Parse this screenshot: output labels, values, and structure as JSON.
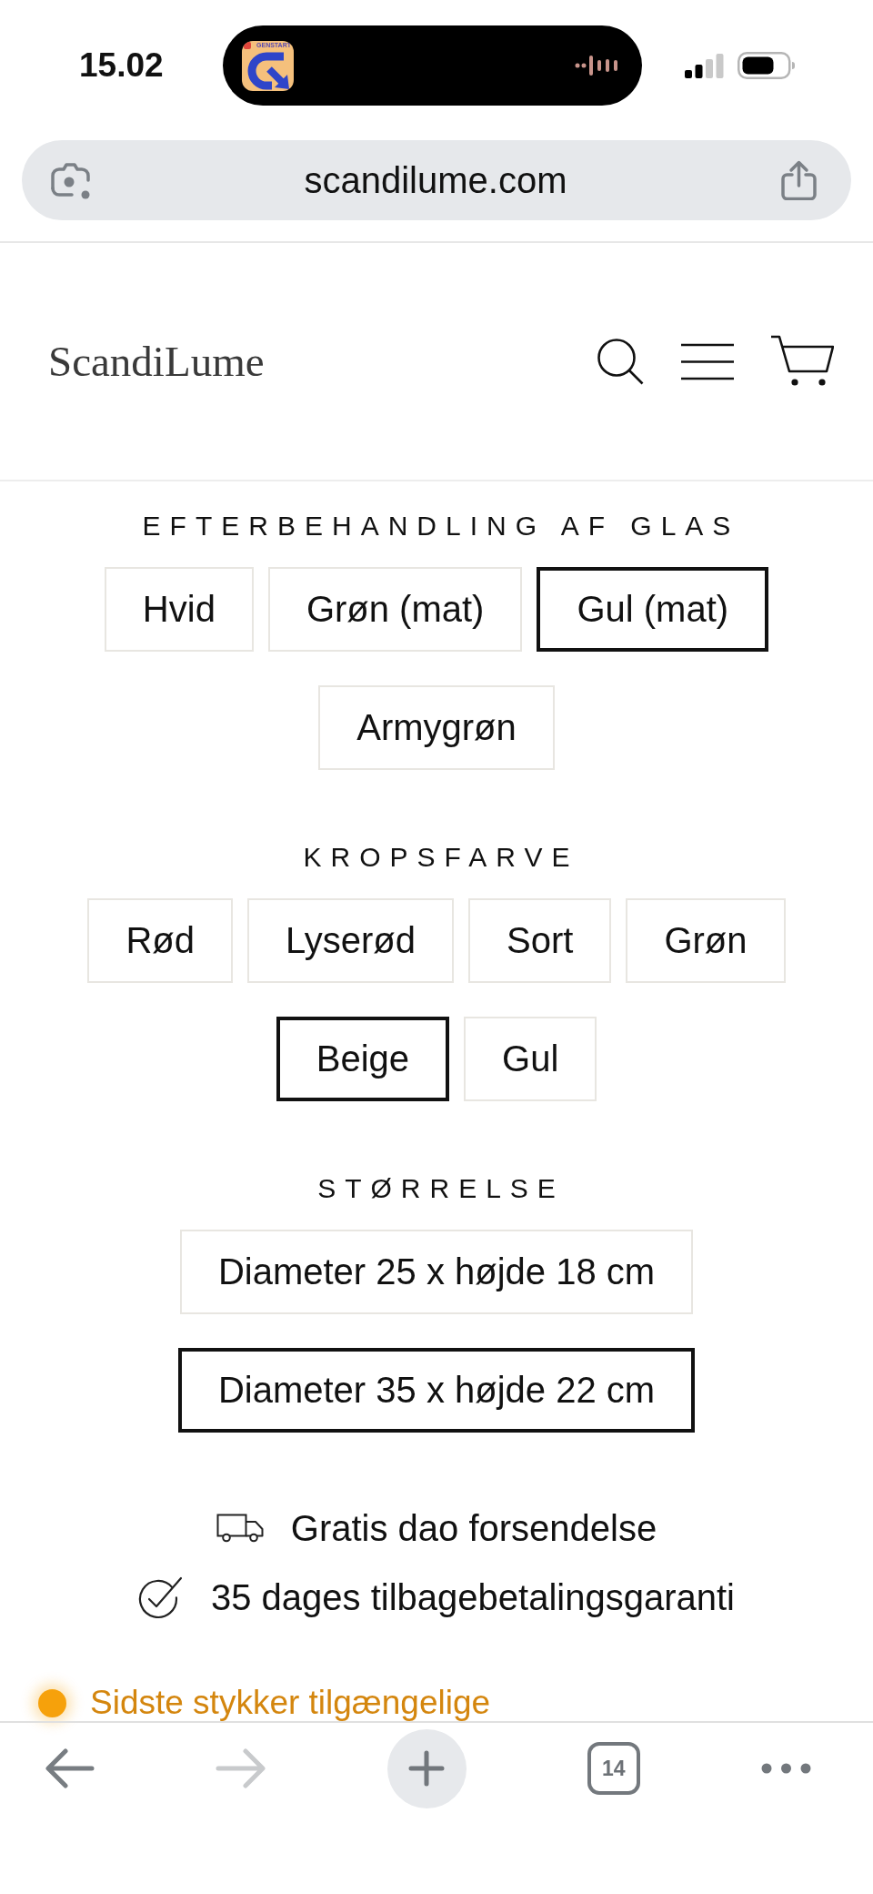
{
  "status_bar": {
    "time": "15.02",
    "live_activity": {
      "app_label": "GENSTART"
    }
  },
  "address_bar": {
    "url": "scandilume.com"
  },
  "header": {
    "logo": "ScandiLume"
  },
  "option_groups": [
    {
      "title": "EFTERBEHANDLING AF GLAS",
      "options": [
        {
          "label": "Hvid",
          "selected": false
        },
        {
          "label": "Grøn (mat)",
          "selected": false
        },
        {
          "label": "Gul (mat)",
          "selected": true
        },
        {
          "label": "Armygrøn",
          "selected": false
        }
      ]
    },
    {
      "title": "KROPSFARVE",
      "options": [
        {
          "label": "Rød",
          "selected": false
        },
        {
          "label": "Lyserød",
          "selected": false
        },
        {
          "label": "Sort",
          "selected": false
        },
        {
          "label": "Grøn",
          "selected": false
        },
        {
          "label": "Beige",
          "selected": true
        },
        {
          "label": "Gul",
          "selected": false
        }
      ]
    },
    {
      "title": "STØRRELSE",
      "options": [
        {
          "label": "Diameter 25 x højde 18 cm",
          "selected": false
        },
        {
          "label": "Diameter 35 x højde 22 cm",
          "selected": true
        }
      ]
    }
  ],
  "perks": [
    {
      "kind": "shipping",
      "text": "Gratis dao forsendelse"
    },
    {
      "kind": "guarantee",
      "text": "35 dages tilbagebetalingsgaranti"
    }
  ],
  "stock_notice": {
    "text": "Sidste stykker tilgængelige"
  },
  "browser_toolbar": {
    "back_disabled": false,
    "forward_disabled": true,
    "tab_count": "14"
  }
}
